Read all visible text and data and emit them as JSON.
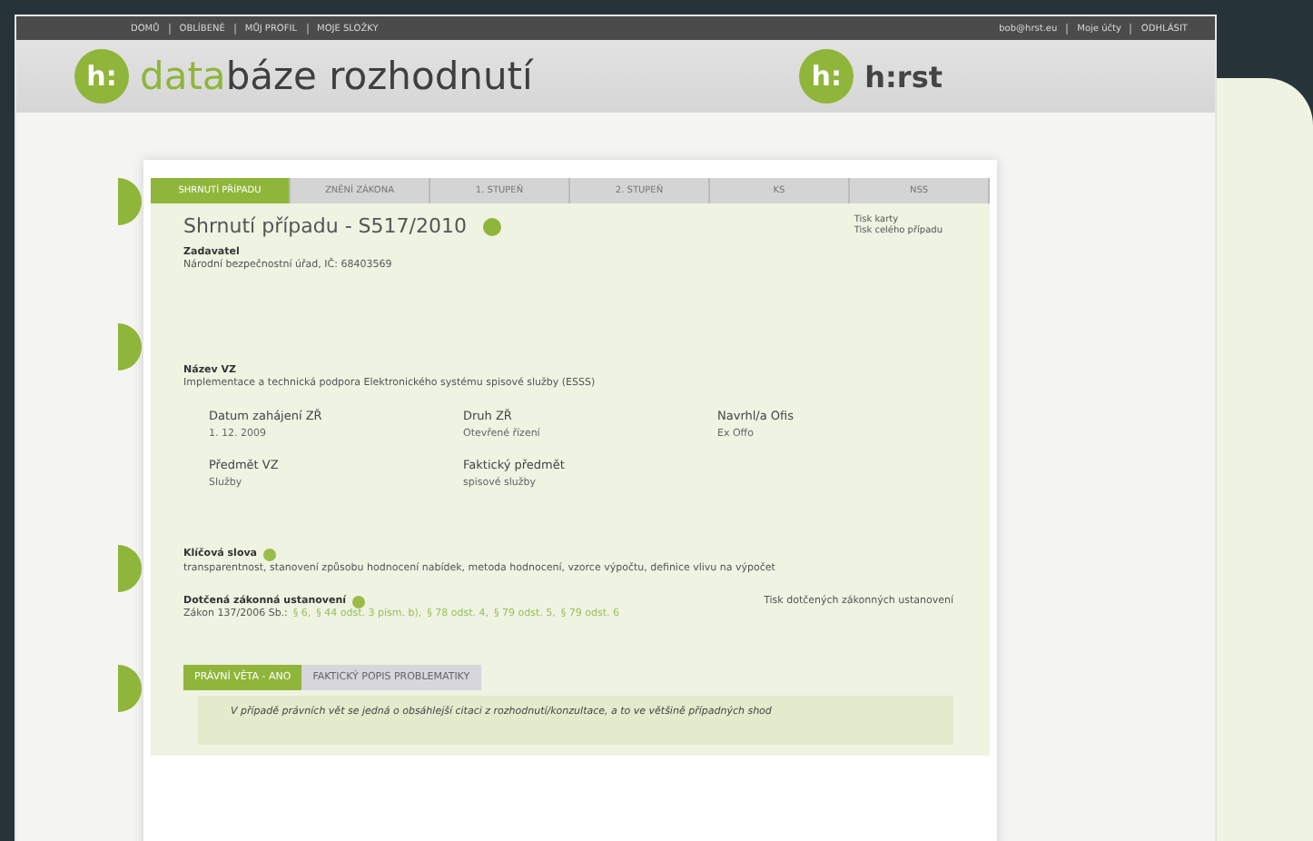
{
  "top_nav": {
    "left": [
      "DOMŮ",
      "OBLÍBENÉ",
      "MŮJ PROFIL",
      "MOJE SLOŽKY"
    ],
    "right": [
      "bob@hrst.eu",
      "Moje účty",
      "ODHLÁSIT"
    ]
  },
  "header": {
    "logo_mark": "h:",
    "logo_accent": "data",
    "logo_rest": "báze rozhodnutí",
    "partner_mark": "h:",
    "partner_name": "h:rst"
  },
  "tabs": [
    {
      "label": "SHRNUTÍ PŘÍPADU",
      "selected": true
    },
    {
      "label": "ZNĚNÍ ZÁKONA",
      "selected": false
    },
    {
      "label": "1. STUPEŇ",
      "selected": false
    },
    {
      "label": "2. STUPEŇ",
      "selected": false
    },
    {
      "label": "KS",
      "selected": false
    },
    {
      "label": "NSS",
      "selected": false
    }
  ],
  "case": {
    "title": "Shrnutí případu - S517/2010",
    "print_links": [
      "Tisk karty",
      "Tisk celého případu"
    ],
    "contracting_authority": {
      "label": "Zadavatel",
      "value": "Národní bezpečnostní úřad, IČ: 68403569"
    },
    "contract_name": {
      "label": "Název VZ",
      "value": "Implementace a technická podpora Elektronického systému spisové služby (ESSS)"
    },
    "facts": [
      {
        "label": "Datum zahájení ZŘ",
        "value": "1. 12. 2009"
      },
      {
        "label": "Druh ZŘ",
        "value": "Otevřené řízení"
      },
      {
        "label": "Navrhl/a Ofis",
        "value": "Ex Offo"
      },
      {
        "label": "Předmět VZ",
        "value": "Služby"
      },
      {
        "label": "Faktický předmět",
        "value": "spisové služby"
      }
    ],
    "keywords": {
      "label": "Klíčová slova",
      "value": "transparentnost, stanovení způsobu hodnocení nabídek, metoda hodnocení, vzorce výpočtu, definice vlivu na výpočet"
    },
    "provisions": {
      "label": "Dotčená zákonná ustanovení",
      "print_link": "Tisk dotčených zákonných ustanovení",
      "law": "Zákon 137/2006 Sb.:",
      "links": [
        "§ 6,",
        "§ 44 odst. 3 písm. b),",
        "§ 78 odst. 4,",
        "§ 79 odst. 5,",
        "§ 79 odst. 6"
      ]
    }
  },
  "bottom_tabs": [
    {
      "label": "PRÁVNÍ VĚTA - ANO",
      "selected": true
    },
    {
      "label": "FAKTICKÝ POPIS PROBLEMATIKY",
      "selected": false
    }
  ],
  "note": "V případě právních vět se jedná o obsáhlejší citaci z rozhodnutí/konzultace, a to ve většině případných shod"
}
